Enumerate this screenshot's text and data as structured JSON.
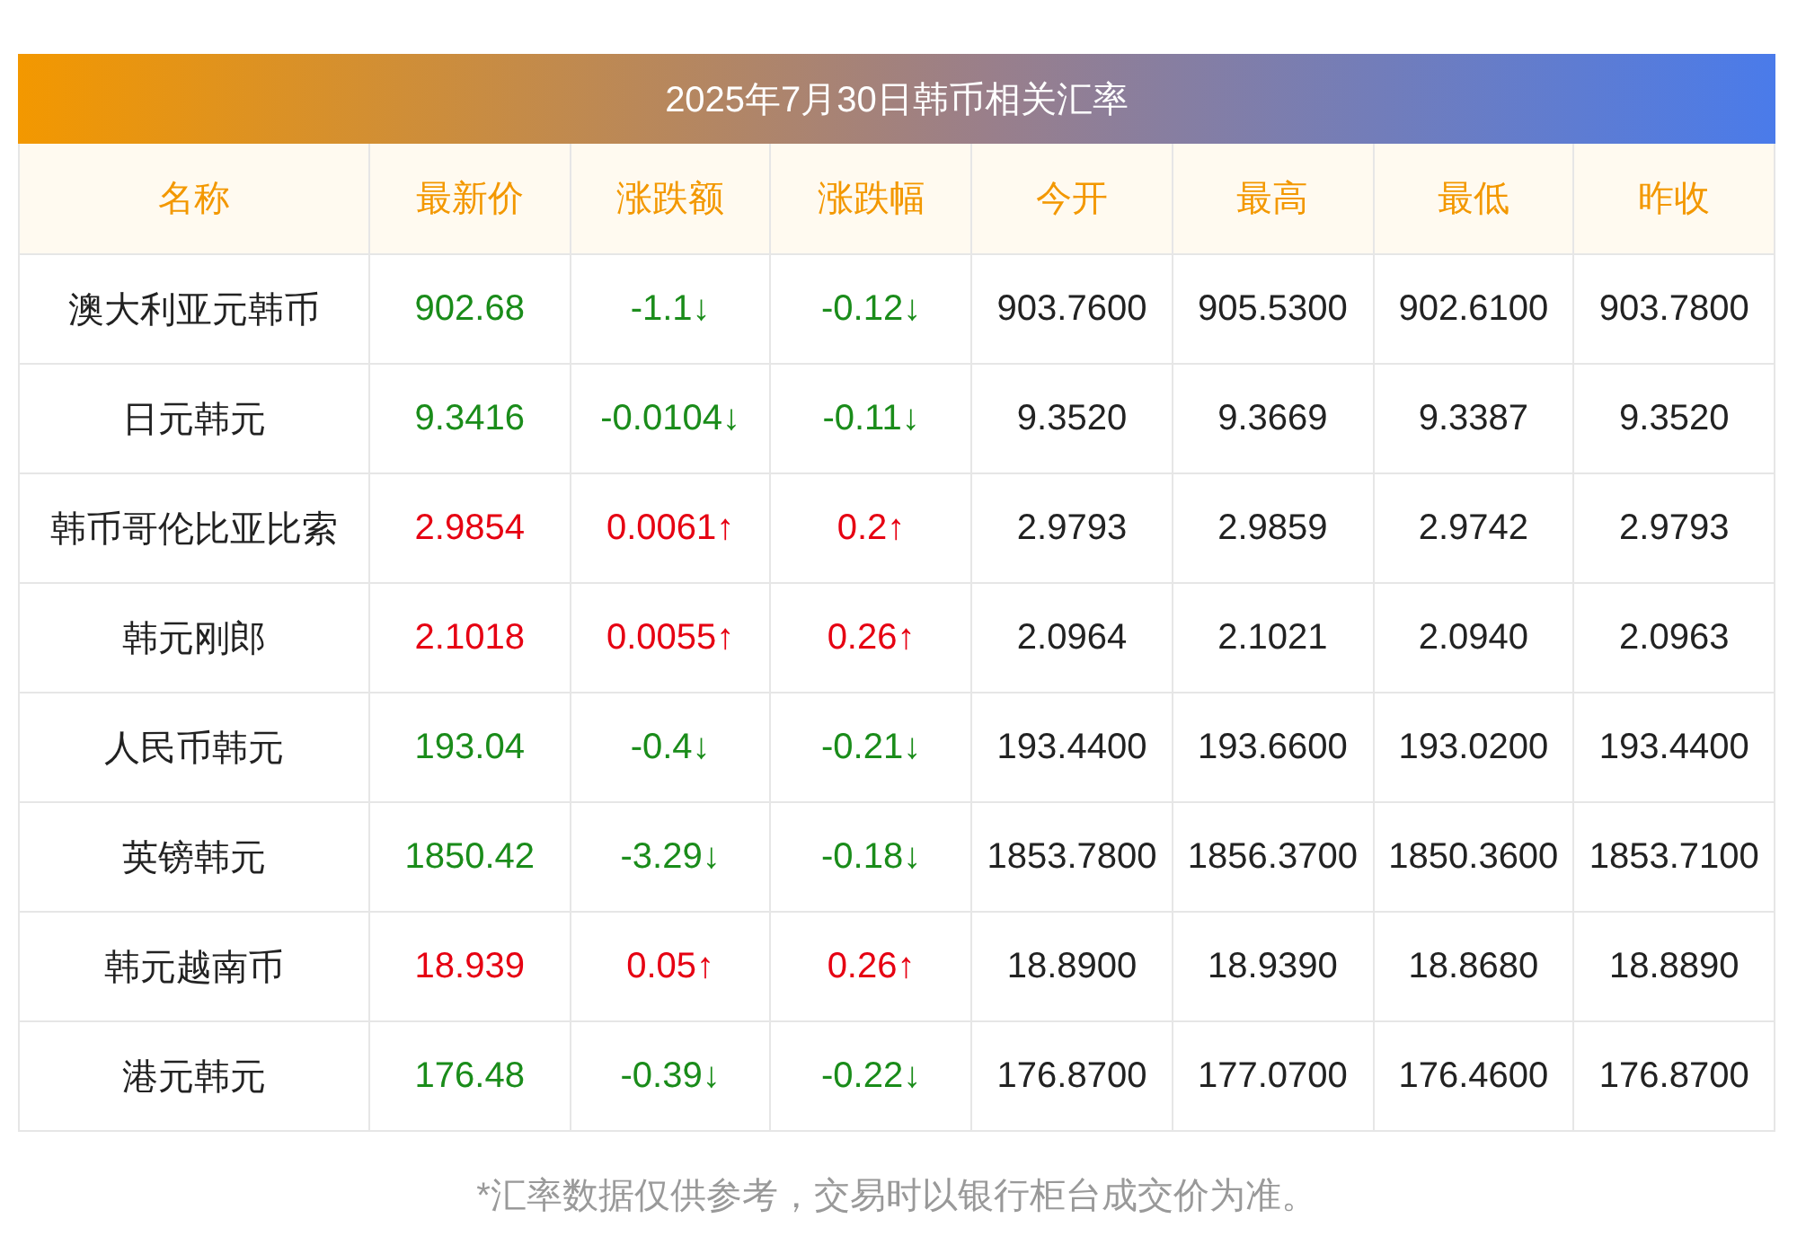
{
  "title": "2025年7月30日韩币相关汇率",
  "columns": [
    "名称",
    "最新价",
    "涨跌额",
    "涨跌幅",
    "今开",
    "最高",
    "最低",
    "昨收"
  ],
  "rows": [
    {
      "color": "#1a8c1a",
      "cells": [
        "澳大利亚元韩币",
        "902.68",
        "-1.1↓",
        "-0.12↓",
        "903.7600",
        "905.5300",
        "902.6100",
        "903.7800"
      ]
    },
    {
      "color": "#1a8c1a",
      "cells": [
        "日元韩元",
        "9.3416",
        "-0.0104↓",
        "-0.11↓",
        "9.3520",
        "9.3669",
        "9.3387",
        "9.3520"
      ]
    },
    {
      "color": "#e60012",
      "cells": [
        "韩币哥伦比亚比索",
        "2.9854",
        "0.0061↑",
        "0.2↑",
        "2.9793",
        "2.9859",
        "2.9742",
        "2.9793"
      ]
    },
    {
      "color": "#e60012",
      "cells": [
        "韩元刚郎",
        "2.1018",
        "0.0055↑",
        "0.26↑",
        "2.0964",
        "2.1021",
        "2.0940",
        "2.0963"
      ]
    },
    {
      "color": "#1a8c1a",
      "cells": [
        "人民币韩元",
        "193.04",
        "-0.4↓",
        "-0.21↓",
        "193.4400",
        "193.6600",
        "193.0200",
        "193.4400"
      ]
    },
    {
      "color": "#1a8c1a",
      "cells": [
        "英镑韩元",
        "1850.42",
        "-3.29↓",
        "-0.18↓",
        "1853.7800",
        "1856.3700",
        "1850.3600",
        "1853.7100"
      ]
    },
    {
      "color": "#e60012",
      "cells": [
        "韩元越南币",
        "18.939",
        "0.05↑",
        "0.26↑",
        "18.8900",
        "18.9390",
        "18.8680",
        "18.8890"
      ]
    },
    {
      "color": "#1a8c1a",
      "cells": [
        "港元韩元",
        "176.48",
        "-0.39↓",
        "-0.22↓",
        "176.8700",
        "177.0700",
        "176.4600",
        "176.8700"
      ]
    }
  ],
  "note": "*汇率数据仅供参考，交易时以银行柜台成交价为准。"
}
